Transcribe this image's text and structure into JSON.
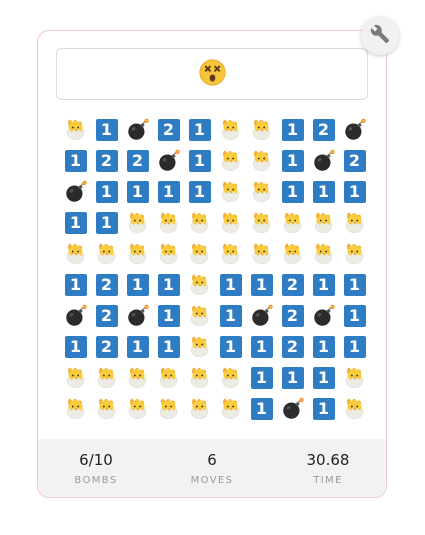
{
  "game": {
    "status_face": "dizzy-face-icon",
    "board": {
      "rows": [
        [
          "chick",
          "1",
          "bomb",
          "2",
          "1",
          "chick",
          "chick",
          "1",
          "2",
          "bomb"
        ],
        [
          "1",
          "2",
          "2",
          "bomb",
          "1",
          "chick",
          "chick",
          "1",
          "bomb",
          "2"
        ],
        [
          "bomb",
          "1",
          "1",
          "1",
          "1",
          "chick",
          "chick",
          "1",
          "1",
          "1"
        ],
        [
          "1",
          "1",
          "chick",
          "chick",
          "chick",
          "chick",
          "chick",
          "chick",
          "chick",
          "chick"
        ],
        [
          "chick",
          "chick",
          "chick",
          "chick",
          "chick",
          "chick",
          "chick",
          "chick",
          "chick",
          "chick"
        ],
        [
          "1",
          "2",
          "1",
          "1",
          "chick",
          "1",
          "1",
          "2",
          "1",
          "1"
        ],
        [
          "bomb",
          "2",
          "bomb",
          "1",
          "chick",
          "1",
          "bomb",
          "2",
          "bomb",
          "1"
        ],
        [
          "1",
          "2",
          "1",
          "1",
          "chick",
          "1",
          "1",
          "2",
          "1",
          "1"
        ],
        [
          "chick",
          "chick",
          "chick",
          "chick",
          "chick",
          "chick",
          "1",
          "1",
          "1",
          "chick"
        ],
        [
          "chick",
          "chick",
          "chick",
          "chick",
          "chick",
          "chick",
          "1",
          "bomb",
          "1",
          "chick"
        ]
      ]
    },
    "stats": {
      "bombs_value": "6/10",
      "bombs_label": "BOMBS",
      "moves_value": "6",
      "moves_label": "MOVES",
      "time_value": "30.68",
      "time_label": "TIME"
    },
    "settings_icon": "wrench-icon",
    "colors": {
      "number_tile": "#2e7cc4",
      "card_border": "#f3c9cc",
      "stats_background": "#f2f2f2"
    }
  }
}
